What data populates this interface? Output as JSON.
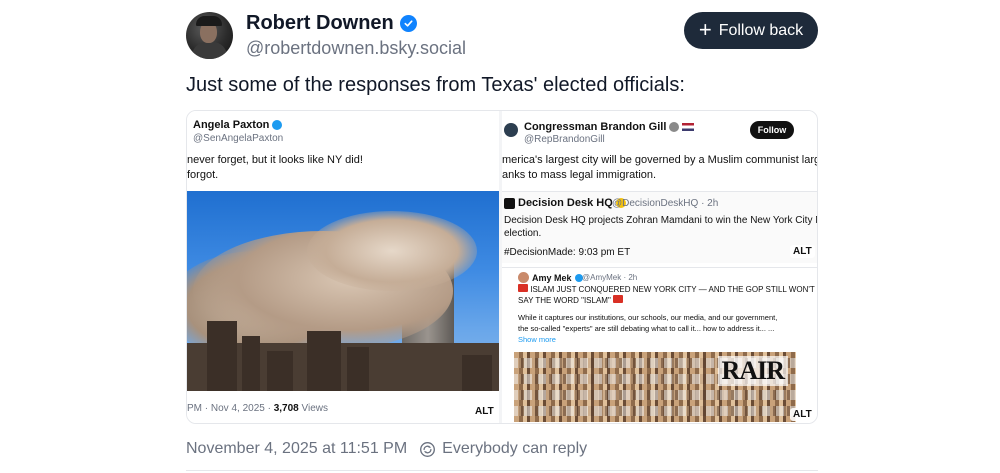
{
  "author": {
    "display_name": "Robert Downen",
    "handle": "@robertdownen.bsky.social",
    "verified": true
  },
  "follow_button": {
    "label": "Follow back"
  },
  "post": {
    "text": "Just some of the responses from Texas' elected officials:",
    "timestamp": "November 4, 2025 at 11:51 PM",
    "reply_setting": "Everybody can reply"
  },
  "media": {
    "left": {
      "name": "Angela Paxton",
      "handle": "@SenAngelaPaxton",
      "line1": "never forget, but it looks like NY did!",
      "line2": "forgot.",
      "meta_prefix": "PM · Nov 4, 2025 · ",
      "views_count": "3,708",
      "views_label": " Views",
      "alt": "ALT"
    },
    "right_top": {
      "name": "Congressman Brandon Gill",
      "handle": "@RepBrandonGill",
      "follow": "Follow",
      "line1": "merica's largest city will be governed by a Muslim communist largely",
      "line2": "anks to mass legal immigration.",
      "quote_name": "Decision Desk HQ",
      "quote_handle": "@DecisionDeskHQ · 2h",
      "quote_line1": "Decision Desk HQ projects Zohran Mamdani to win the New York City Mayor",
      "quote_line2": "election.",
      "quote_tag": "#DecisionMade: 9:03 pm ET",
      "alt": "ALT"
    },
    "right_bottom": {
      "name": "Amy Mek",
      "handle": "@AmyMek · 2h",
      "line1": "ISLAM JUST CONQUERED NEW YORK CITY — AND THE GOP STILL WON'T",
      "line2": "SAY THE WORD \"ISLAM\"",
      "line3": "While it captures our institutions, our schools, our media, and our government,",
      "line4": "the so-called \"experts\" are still debating what to call it... how to address it... ...",
      "show_more": "Show more",
      "watermark": "RAIR",
      "alt": "ALT"
    }
  },
  "icons": {
    "verified": "verified-check-icon",
    "plus": "plus-icon",
    "reply": "reply-settings-icon"
  },
  "colors": {
    "follow_button_bg": "#1e2a3a",
    "verified_blue": "#1083fe",
    "muted_text": "#6b7280"
  }
}
